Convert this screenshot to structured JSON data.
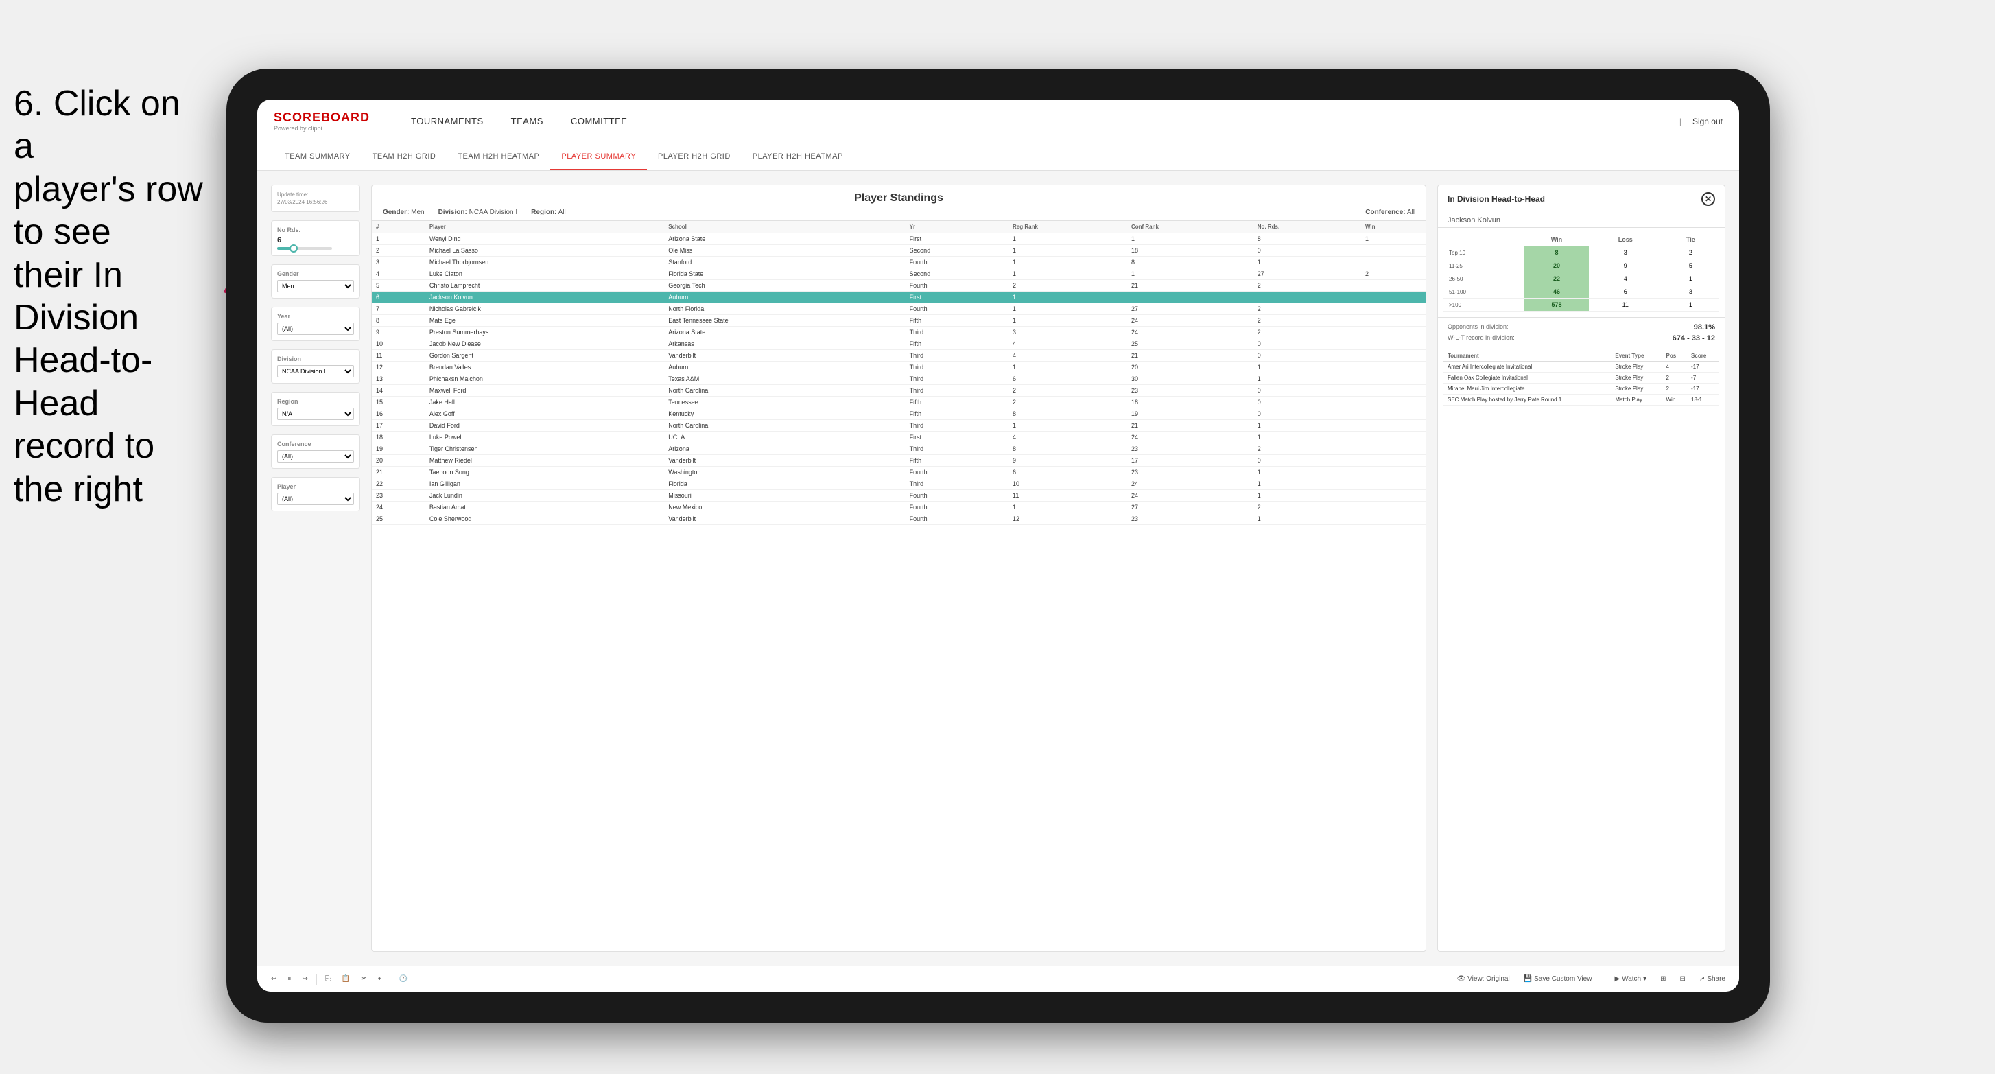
{
  "instruction": {
    "line1": "6. Click on a",
    "line2": "player's row to see",
    "line3": "their In Division",
    "line4": "Head-to-Head",
    "line5": "record to the right"
  },
  "header": {
    "logo": "SCOREBOARD",
    "logo_sub": "Powered by clippi",
    "nav": [
      "TOURNAMENTS",
      "TEAMS",
      "COMMITTEE"
    ],
    "sign_out": "Sign out"
  },
  "sub_nav": {
    "items": [
      "TEAM SUMMARY",
      "TEAM H2H GRID",
      "TEAM H2H HEATMAP",
      "PLAYER SUMMARY",
      "PLAYER H2H GRID",
      "PLAYER H2H HEATMAP"
    ],
    "active": "PLAYER SUMMARY"
  },
  "sidebar": {
    "update_time_label": "Update time:",
    "update_time_value": "27/03/2024 16:56:26",
    "no_rds_label": "No Rds.",
    "no_rds_value": "6",
    "gender_label": "Gender",
    "gender_value": "Men",
    "year_label": "Year",
    "year_value": "(All)",
    "division_label": "Division",
    "division_value": "NCAA Division I",
    "region_label": "Region",
    "region_value": "N/A",
    "conference_label": "Conference",
    "conference_value": "(All)",
    "player_label": "Player",
    "player_value": "(All)"
  },
  "standings": {
    "title": "Player Standings",
    "gender_label": "Gender:",
    "gender_value": "Men",
    "division_label": "Division:",
    "division_value": "NCAA Division I",
    "region_label": "Region:",
    "region_value": "All",
    "conference_label": "Conference:",
    "conference_value": "All",
    "columns": [
      "#",
      "Player",
      "School",
      "Yr",
      "Reg Rank",
      "Conf Rank",
      "No. Rds.",
      "Win"
    ],
    "rows": [
      {
        "num": "1",
        "player": "Wenyi Ding",
        "school": "Arizona State",
        "yr": "First",
        "reg": "1",
        "conf": "1",
        "rds": "8",
        "win": "1"
      },
      {
        "num": "2",
        "player": "Michael La Sasso",
        "school": "Ole Miss",
        "yr": "Second",
        "reg": "1",
        "conf": "18",
        "rds": "0",
        "win": ""
      },
      {
        "num": "3",
        "player": "Michael Thorbjornsen",
        "school": "Stanford",
        "yr": "Fourth",
        "reg": "1",
        "conf": "8",
        "rds": "1",
        "win": ""
      },
      {
        "num": "4",
        "player": "Luke Claton",
        "school": "Florida State",
        "yr": "Second",
        "reg": "1",
        "conf": "1",
        "rds": "27",
        "win": "2"
      },
      {
        "num": "5",
        "player": "Christo Lamprecht",
        "school": "Georgia Tech",
        "yr": "Fourth",
        "reg": "2",
        "conf": "21",
        "rds": "2",
        "win": ""
      },
      {
        "num": "6",
        "player": "Jackson Koivun",
        "school": "Auburn",
        "yr": "First",
        "reg": "1",
        "conf": "",
        "rds": "",
        "win": "",
        "highlighted": true
      },
      {
        "num": "7",
        "player": "Nicholas Gabrelcik",
        "school": "North Florida",
        "yr": "Fourth",
        "reg": "1",
        "conf": "27",
        "rds": "2",
        "win": ""
      },
      {
        "num": "8",
        "player": "Mats Ege",
        "school": "East Tennessee State",
        "yr": "Fifth",
        "reg": "1",
        "conf": "24",
        "rds": "2",
        "win": ""
      },
      {
        "num": "9",
        "player": "Preston Summerhays",
        "school": "Arizona State",
        "yr": "Third",
        "reg": "3",
        "conf": "24",
        "rds": "2",
        "win": ""
      },
      {
        "num": "10",
        "player": "Jacob New Diease",
        "school": "Arkansas",
        "yr": "Fifth",
        "reg": "4",
        "conf": "25",
        "rds": "0",
        "win": ""
      },
      {
        "num": "11",
        "player": "Gordon Sargent",
        "school": "Vanderbilt",
        "yr": "Third",
        "reg": "4",
        "conf": "21",
        "rds": "0",
        "win": ""
      },
      {
        "num": "12",
        "player": "Brendan Valles",
        "school": "Auburn",
        "yr": "Third",
        "reg": "1",
        "conf": "20",
        "rds": "1",
        "win": ""
      },
      {
        "num": "13",
        "player": "Phichaksn Maichon",
        "school": "Texas A&M",
        "yr": "Third",
        "reg": "6",
        "conf": "30",
        "rds": "1",
        "win": ""
      },
      {
        "num": "14",
        "player": "Maxwell Ford",
        "school": "North Carolina",
        "yr": "Third",
        "reg": "2",
        "conf": "23",
        "rds": "0",
        "win": ""
      },
      {
        "num": "15",
        "player": "Jake Hall",
        "school": "Tennessee",
        "yr": "Fifth",
        "reg": "2",
        "conf": "18",
        "rds": "0",
        "win": ""
      },
      {
        "num": "16",
        "player": "Alex Goff",
        "school": "Kentucky",
        "yr": "Fifth",
        "reg": "8",
        "conf": "19",
        "rds": "0",
        "win": ""
      },
      {
        "num": "17",
        "player": "David Ford",
        "school": "North Carolina",
        "yr": "Third",
        "reg": "1",
        "conf": "21",
        "rds": "1",
        "win": ""
      },
      {
        "num": "18",
        "player": "Luke Powell",
        "school": "UCLA",
        "yr": "First",
        "reg": "4",
        "conf": "24",
        "rds": "1",
        "win": ""
      },
      {
        "num": "19",
        "player": "Tiger Christensen",
        "school": "Arizona",
        "yr": "Third",
        "reg": "8",
        "conf": "23",
        "rds": "2",
        "win": ""
      },
      {
        "num": "20",
        "player": "Matthew Riedel",
        "school": "Vanderbilt",
        "yr": "Fifth",
        "reg": "9",
        "conf": "17",
        "rds": "0",
        "win": ""
      },
      {
        "num": "21",
        "player": "Taehoon Song",
        "school": "Washington",
        "yr": "Fourth",
        "reg": "6",
        "conf": "23",
        "rds": "1",
        "win": ""
      },
      {
        "num": "22",
        "player": "Ian Gilligan",
        "school": "Florida",
        "yr": "Third",
        "reg": "10",
        "conf": "24",
        "rds": "1",
        "win": ""
      },
      {
        "num": "23",
        "player": "Jack Lundin",
        "school": "Missouri",
        "yr": "Fourth",
        "reg": "11",
        "conf": "24",
        "rds": "1",
        "win": ""
      },
      {
        "num": "24",
        "player": "Bastian Amat",
        "school": "New Mexico",
        "yr": "Fourth",
        "reg": "1",
        "conf": "27",
        "rds": "2",
        "win": ""
      },
      {
        "num": "25",
        "player": "Cole Sherwood",
        "school": "Vanderbilt",
        "yr": "Fourth",
        "reg": "12",
        "conf": "23",
        "rds": "1",
        "win": ""
      }
    ]
  },
  "h2h": {
    "title": "In Division Head-to-Head",
    "player": "Jackson Koivun",
    "columns": [
      "",
      "Win",
      "Loss",
      "Tie"
    ],
    "rows": [
      {
        "rank": "Top 10",
        "win": "8",
        "loss": "3",
        "tie": "2",
        "win_highlight": true
      },
      {
        "rank": "11-25",
        "win": "20",
        "loss": "9",
        "tie": "5",
        "win_highlight": true
      },
      {
        "rank": "26-50",
        "win": "22",
        "loss": "4",
        "tie": "1",
        "win_highlight": true
      },
      {
        "rank": "51-100",
        "win": "46",
        "loss": "6",
        "tie": "3",
        "win_highlight": true
      },
      {
        "rank": ">100",
        "win": "578",
        "loss": "11",
        "tie": "1",
        "win_highlight": true
      }
    ],
    "opponents_label": "Opponents in division:",
    "record_label": "W-L-T record in-division:",
    "pct_value": "98.1%",
    "record_value": "674 - 33 - 12",
    "tournament_columns": [
      "Tournament",
      "Event Type",
      "Pos",
      "Score"
    ],
    "tournaments": [
      {
        "name": "Amer Ari Intercollegiate Invitational",
        "type": "Stroke Play",
        "pos": "4",
        "score": "-17"
      },
      {
        "name": "Fallen Oak Collegiate Invitational",
        "type": "Stroke Play",
        "pos": "2",
        "score": "-7"
      },
      {
        "name": "Mirabel Maui Jim Intercollegiate",
        "type": "Stroke Play",
        "pos": "2",
        "score": "-17"
      },
      {
        "name": "SEC Match Play hosted by Jerry Pate Round 1",
        "type": "Match Play",
        "pos": "Win",
        "score": "18-1"
      }
    ]
  },
  "toolbar": {
    "view_original": "View: Original",
    "save_custom": "Save Custom View",
    "watch": "Watch",
    "share": "Share"
  }
}
